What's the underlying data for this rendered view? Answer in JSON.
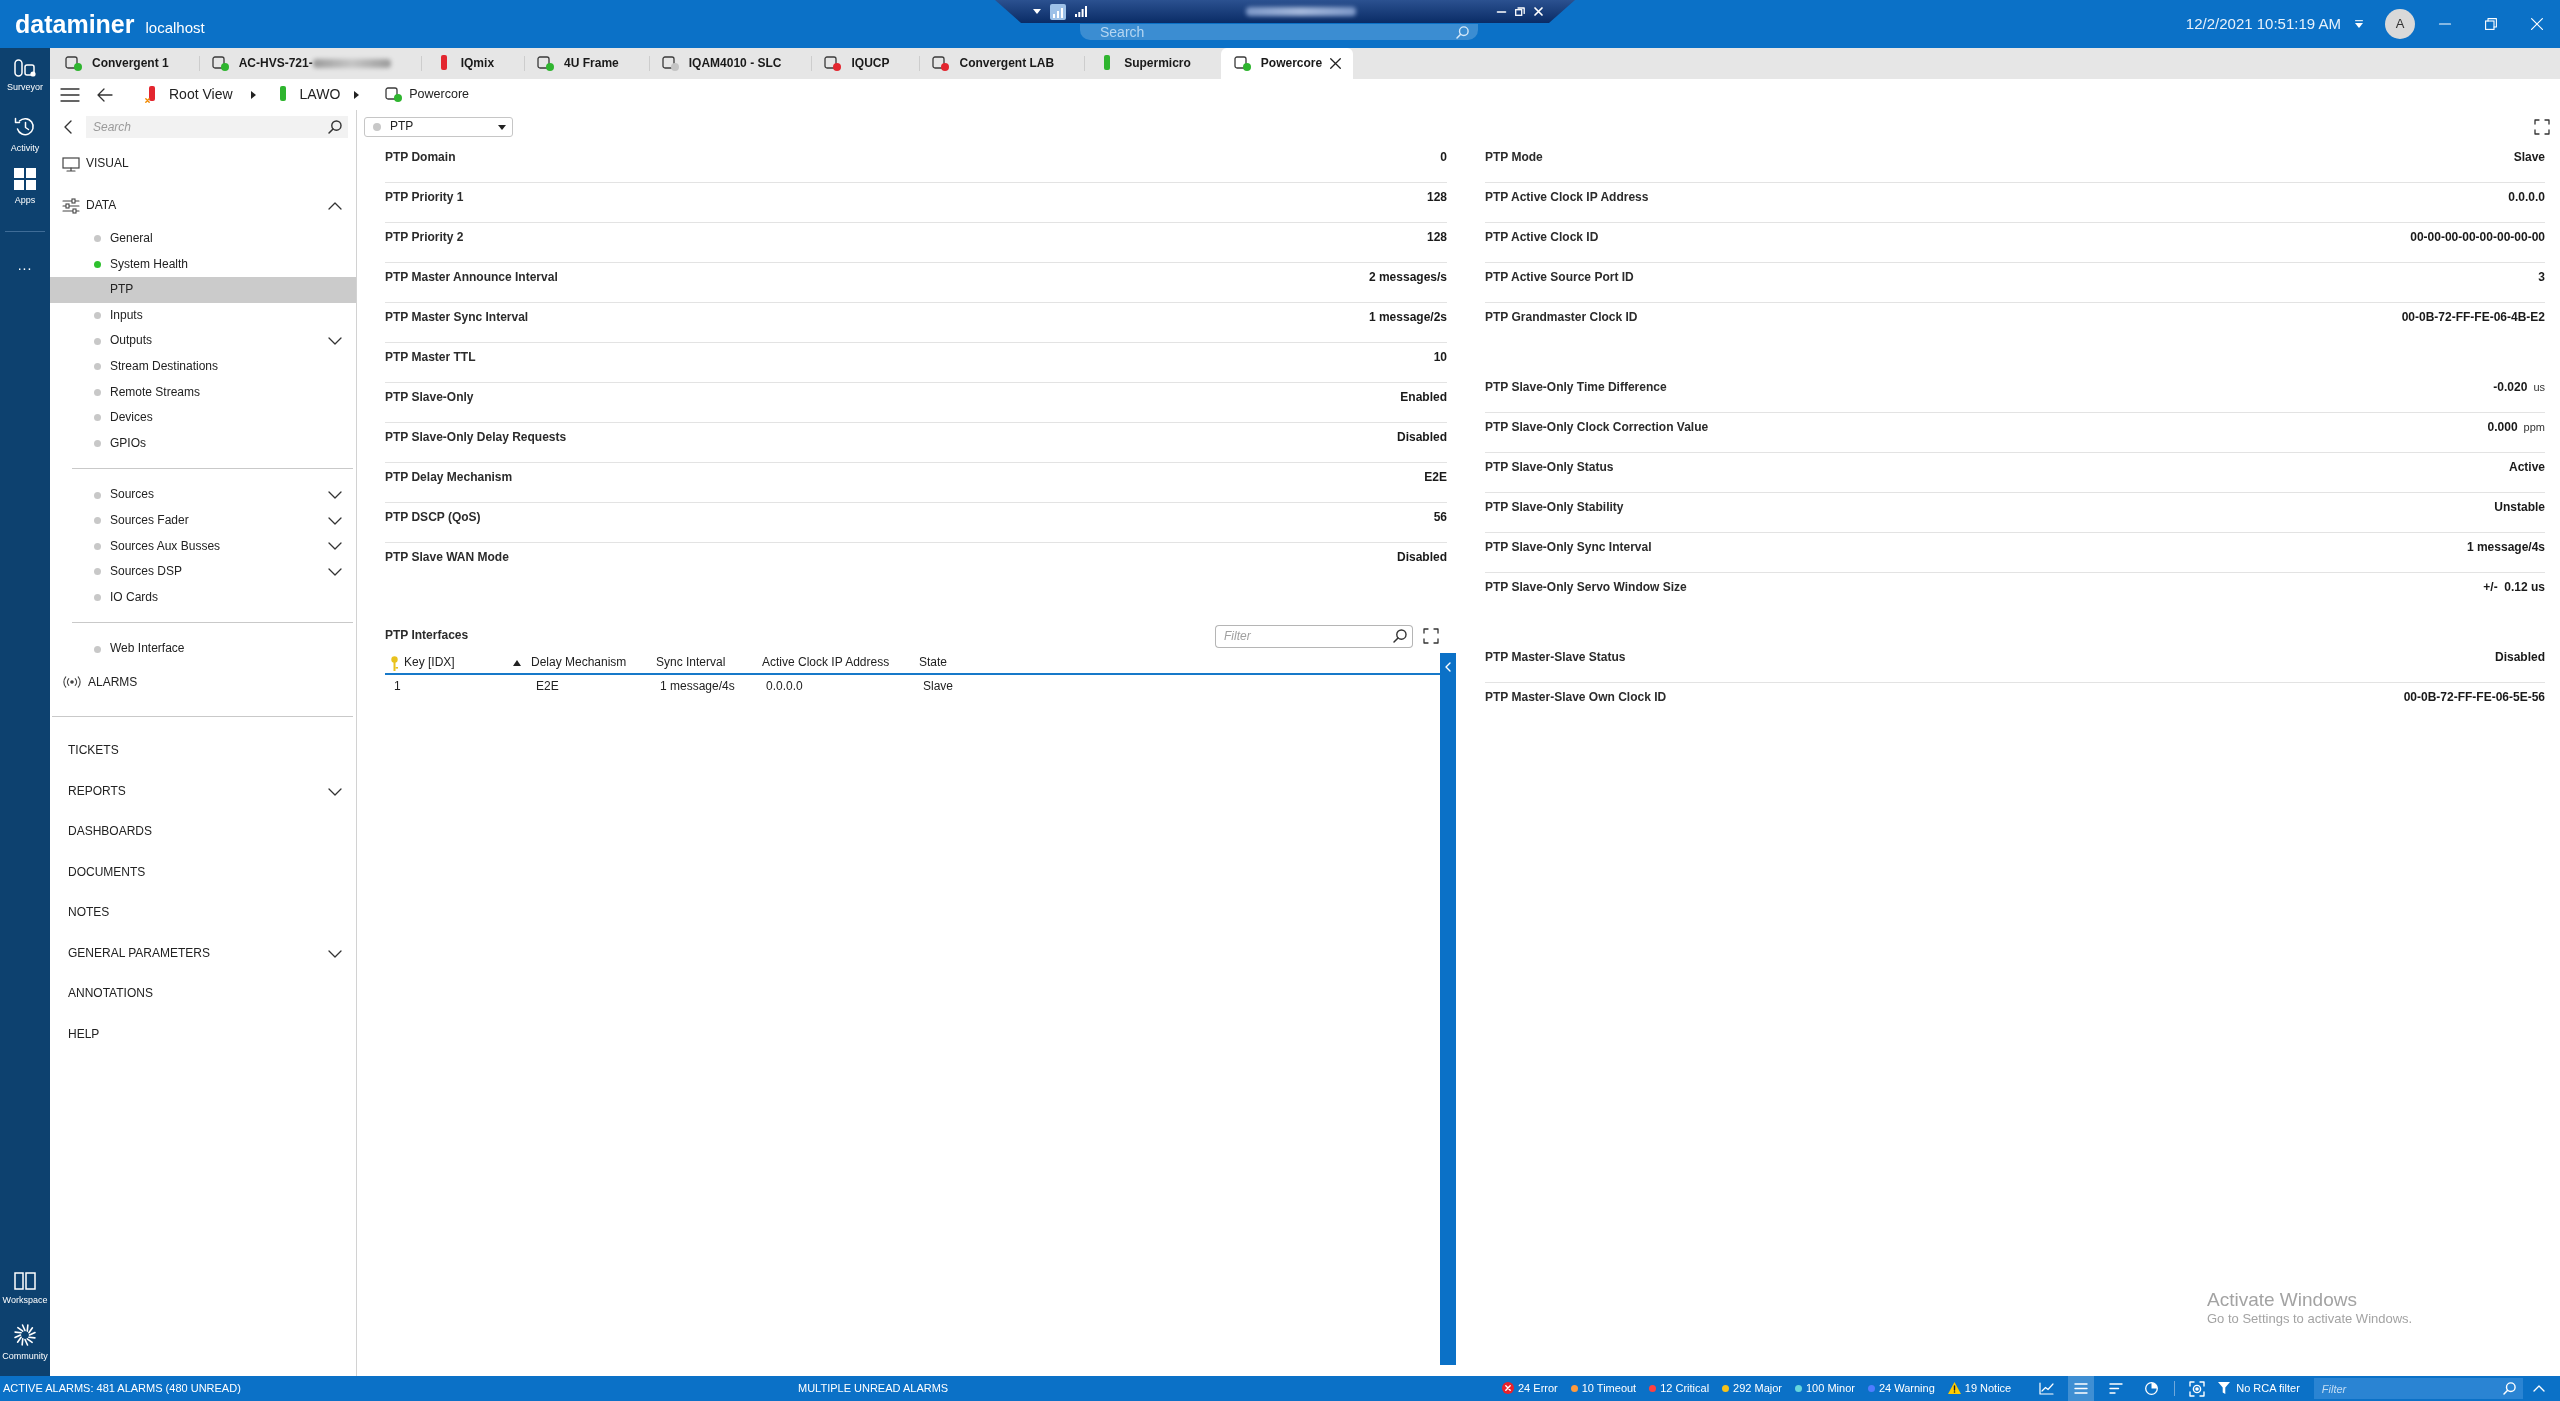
{
  "topbar": {
    "brand": "dataminer",
    "host": "localhost",
    "search": {
      "placeholder": "Search"
    },
    "datetime": "12/2/2021 10:51:19 AM",
    "avatar": "A"
  },
  "rail": {
    "items": [
      {
        "label": "Surveyor"
      },
      {
        "label": "Activity"
      },
      {
        "label": "Apps"
      }
    ],
    "more": "...",
    "bottom_items": [
      {
        "label": "Workspace"
      },
      {
        "label": "Community"
      }
    ]
  },
  "tabs": [
    {
      "label": "Convergent 1",
      "kind": "element",
      "color": "#2fb52f",
      "selected": false,
      "redacted": false
    },
    {
      "label": "AC-HVS-721-",
      "kind": "element",
      "color": "#2fb52f",
      "selected": false,
      "redacted": true
    },
    {
      "label": "IQmix",
      "kind": "bar",
      "color": "#e3262f",
      "selected": false,
      "redacted": false
    },
    {
      "label": "4U Frame",
      "kind": "element",
      "color": "#2fb52f",
      "selected": false,
      "redacted": false
    },
    {
      "label": "IQAM4010 - SLC",
      "kind": "element",
      "color": "#c4c4c4",
      "selected": false,
      "redacted": false
    },
    {
      "label": "IQUCP",
      "kind": "element",
      "color": "#e3262f",
      "selected": false,
      "redacted": false
    },
    {
      "label": "Convergent LAB",
      "kind": "element",
      "color": "#e3262f",
      "selected": false,
      "redacted": false
    },
    {
      "label": "Supermicro",
      "kind": "bar",
      "color": "#2fb52f",
      "selected": false,
      "redacted": false
    },
    {
      "label": "Powercore",
      "kind": "element",
      "color": "#2fb52f",
      "selected": true,
      "redacted": false
    }
  ],
  "breadcrumb": [
    {
      "label": "Root View",
      "kind": "bar",
      "color": "#e3262f",
      "flagged": true
    },
    {
      "label": "LAWO",
      "kind": "bar",
      "color": "#2fb52f",
      "flagged": false
    },
    {
      "label": "Powercore",
      "kind": "element",
      "color": "#2fb52f",
      "flagged": false
    }
  ],
  "sidebar": {
    "search": {
      "placeholder": "Search"
    },
    "sections": [
      {
        "label": "VISUAL"
      },
      {
        "label": "DATA",
        "expanded": true,
        "children": [
          {
            "children": [
              {
                "label": "General",
                "color": "#c8c8c8",
                "selected": false
              },
              {
                "label": "System Health",
                "color": "#2ec12e",
                "selected": false
              },
              {
                "label": "PTP",
                "selected": true
              },
              {
                "label": "Inputs",
                "color": "#c8c8c8",
                "selected": false
              },
              {
                "label": "Outputs",
                "color": "#c8c8c8",
                "selected": false,
                "expanded": false
              },
              {
                "label": "Stream Destinations",
                "color": "#c8c8c8",
                "selected": false
              },
              {
                "label": "Remote Streams",
                "color": "#c8c8c8",
                "selected": false
              },
              {
                "label": "Devices",
                "color": "#c8c8c8",
                "selected": false
              },
              {
                "label": "GPIOs",
                "color": "#c8c8c8",
                "selected": false
              }
            ]
          },
          {
            "children": [
              {
                "label": "Sources",
                "color": "#c8c8c8",
                "selected": false,
                "expanded": false
              },
              {
                "label": "Sources Fader",
                "color": "#c8c8c8",
                "selected": false,
                "expanded": false
              },
              {
                "label": "Sources Aux Busses",
                "color": "#c8c8c8",
                "selected": false,
                "expanded": false
              },
              {
                "label": "Sources DSP",
                "color": "#c8c8c8",
                "selected": false,
                "expanded": false
              },
              {
                "label": "IO Cards",
                "color": "#c8c8c8",
                "selected": false
              }
            ]
          },
          {
            "children": [
              {
                "label": "Web Interface",
                "color": "#c8c8c8",
                "selected": false
              }
            ]
          }
        ]
      },
      {
        "label": "ALARMS"
      }
    ],
    "menu": [
      {
        "label": "TICKETS"
      },
      {
        "label": "REPORTS",
        "expanded": false
      },
      {
        "label": "DASHBOARDS"
      },
      {
        "label": "DOCUMENTS"
      },
      {
        "label": "NOTES"
      },
      {
        "label": "GENERAL PARAMETERS",
        "expanded": false
      },
      {
        "label": "ANNOTATIONS"
      },
      {
        "label": "HELP"
      }
    ]
  },
  "panel": {
    "selector": {
      "value": "PTP"
    },
    "left": [
      {
        "rows": [
          {
            "label": "PTP Domain",
            "value": "0"
          },
          {
            "label": "PTP Priority 1",
            "value": "128"
          },
          {
            "label": "PTP Priority 2",
            "value": "128"
          },
          {
            "label": "PTP Master Announce Interval",
            "value": "2 messages/s"
          },
          {
            "label": "PTP Master Sync Interval",
            "value": "1 message/2s"
          },
          {
            "label": "PTP Master TTL",
            "value": "10"
          },
          {
            "label": "PTP Slave-Only",
            "value": "Enabled"
          },
          {
            "label": "PTP Slave-Only Delay Requests",
            "value": "Disabled"
          },
          {
            "label": "PTP Delay Mechanism",
            "value": "E2E"
          },
          {
            "label": "PTP DSCP (QoS)",
            "value": "56"
          },
          {
            "label": "PTP Slave WAN Mode",
            "value": "Disabled"
          }
        ]
      }
    ],
    "right": [
      {
        "rows": [
          {
            "label": "PTP Mode",
            "value": "Slave"
          },
          {
            "label": "PTP Active Clock IP Address",
            "value": "0.0.0.0"
          },
          {
            "label": "PTP Active Clock ID",
            "value": "00-00-00-00-00-00-00-00"
          },
          {
            "label": "PTP Active Source Port ID",
            "value": "3"
          },
          {
            "label": "PTP Grandmaster Clock ID",
            "value": "00-0B-72-FF-FE-06-4B-E2"
          }
        ]
      },
      {
        "rows": [
          {
            "label": "PTP Slave-Only Time Difference",
            "value": "-0.020",
            "unit": "us"
          },
          {
            "label": "PTP Slave-Only Clock Correction Value",
            "value": "0.000",
            "unit": "ppm"
          },
          {
            "label": "PTP Slave-Only Status",
            "value": "Active"
          },
          {
            "label": "PTP Slave-Only Stability",
            "value": "Unstable"
          },
          {
            "label": "PTP Slave-Only Sync Interval",
            "value": "1 message/4s"
          },
          {
            "label": "PTP Slave-Only Servo Window Size",
            "value": "+/-  0.12 us"
          }
        ]
      },
      {
        "rows": [
          {
            "label": "PTP Master-Slave Status",
            "value": "Disabled"
          },
          {
            "label": "PTP Master-Slave Own Clock ID",
            "value": "00-0B-72-FF-FE-06-5E-56"
          }
        ]
      }
    ],
    "interfaces": {
      "title": "PTP Interfaces",
      "filter": {
        "placeholder": "Filter"
      },
      "columns": [
        {
          "label": "Key [IDX]",
          "primary_key": true
        },
        {
          "label": "Delay Mechanism",
          "sorted": true
        },
        {
          "label": "Sync Interval"
        },
        {
          "label": "Active Clock IP Address"
        },
        {
          "label": "State"
        }
      ],
      "rows": [
        [
          "1",
          "E2E",
          "1 message/4s",
          "0.0.0.0",
          "Slave"
        ]
      ]
    }
  },
  "status_bar": {
    "summary": "ACTIVE ALARMS: 481 ALARMS (480 UNREAD)",
    "notice": "MULTIPLE UNREAD ALARMS",
    "counters": [
      {
        "label": "24 Error",
        "kind": "cross",
        "color": "#e8222b"
      },
      {
        "label": "10 Timeout",
        "kind": "dot",
        "color": "#ff9a3c"
      },
      {
        "label": "12 Critical",
        "kind": "dot",
        "color": "#ff4040"
      },
      {
        "label": "292 Major",
        "kind": "dot",
        "color": "#f7c21a"
      },
      {
        "label": "100 Minor",
        "kind": "dot",
        "color": "#66d6dc"
      },
      {
        "label": "24 Warning",
        "kind": "dot",
        "color": "#4f7cff"
      },
      {
        "label": "19 Notice",
        "kind": "triangle",
        "color": "#ffcc00"
      }
    ],
    "views": [
      {
        "selected": false
      },
      {
        "selected": true
      },
      {
        "selected": false
      },
      {
        "selected": false
      }
    ],
    "rca_filter": "No RCA filter",
    "filter": {
      "placeholder": "Filter"
    }
  },
  "os_notice": {
    "title": "Activate Windows",
    "text": "Go to Settings to activate Windows."
  }
}
